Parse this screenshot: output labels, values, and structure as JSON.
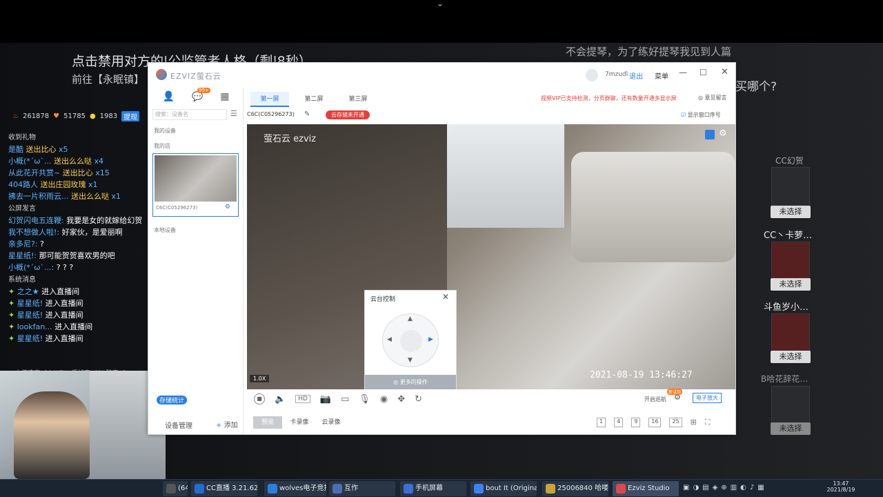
{
  "overlay": {
    "title": "点击禁用对方的|公监管者人格（剩|8秒）",
    "subtitle": "前往【永眠镇】",
    "right_top": "不会提琴，为了练好提琴我见到人篇",
    "right_q": "买哪个?",
    "stats": {
      "heat": "261878",
      "fans": "51785",
      "count": "1983",
      "badge": "提现"
    },
    "sections": {
      "gifts": "收到礼物",
      "public": "公屏发言",
      "system": "系统消息"
    },
    "gift_rows": [
      {
        "name": "是酷",
        "text": "送出比心",
        "count": "x5"
      },
      {
        "name": "小概(*´ω`...",
        "text": "送出么么哒",
        "count": "x4"
      },
      {
        "name": "从此花开共赏~",
        "text": "送出比心",
        "count": "x15"
      },
      {
        "name": "404路人",
        "text": "送出庄园玫瑰",
        "count": "x1"
      },
      {
        "name": "拂去一片积雨云...",
        "text": "送出么么哒",
        "count": "x1"
      }
    ],
    "public_rows": [
      {
        "name": "幻贺闪电五连鞭:",
        "text": "我要是女的就嫁给幻贺"
      },
      {
        "name": "我不想做人啦!:",
        "text": "好家伙，是爱丽啊"
      },
      {
        "name": "亲多尼?:",
        "text": "?"
      },
      {
        "name": "星星纸!:",
        "text": "那可能贺贺喜欢男的吧"
      },
      {
        "name": "小概(*´ω`...:",
        "text": "? ? ?"
      }
    ],
    "system_rows": [
      {
        "name": "之之★",
        "text": "进入直播间"
      },
      {
        "name": "星星纸!",
        "text": "进入直播间"
      },
      {
        "name": "星星纸!",
        "text": "进入直播间"
      },
      {
        "name": "lookfan...",
        "text": "进入直播间"
      },
      {
        "name": "星星纸!",
        "text": "进入直播间"
      }
    ],
    "bottom_bar": "上传速度: 204KB/s  丢帧率: 0%  码率: 3ms",
    "lottery": {
      "title1": "CC幻贺",
      "user1": "CC丶卡萝…",
      "user2": "斗鱼岁小…",
      "title2": "B哈花辞花…",
      "btn": "未选择"
    }
  },
  "app": {
    "logo": "EZVIZ萤石云",
    "user": "7mzudl",
    "logout": "退出",
    "menu": "菜单",
    "tabs": [
      "第一屏",
      "第二屏",
      "第三屏"
    ],
    "promo": "视频VIP已支持检测，分页群聊，还有数量开通多显示屏",
    "feedback": "意见留言",
    "notif_badge": "99+",
    "search_placeholder": "搜索：设备名",
    "my_devices": "我的设备",
    "my_store": "我的店",
    "device_id": "C6C(C05296273)",
    "local_devices": "本地设备",
    "device_manage": "设备管理",
    "add": "添加",
    "camera_label": "C6C(C05296273)",
    "cloud_badge": "云存储未开通",
    "show_window_no": "显示窗口序号",
    "watermark": "萤石云 ezviz",
    "timestamp": "2021-08-19  13:46:27",
    "zoom": "1.0X",
    "ptz": {
      "title": "云台控制",
      "more": "更多的操作"
    },
    "bottom_tabs": [
      "预览",
      "卡录像",
      "云录像"
    ],
    "open_tip": "开启巡航",
    "ext_btn": "电子放大",
    "new_badge": "新试用",
    "layouts": [
      "1",
      "4",
      "9",
      "16",
      "25"
    ],
    "left_badge": "存储统计"
  },
  "taskbar": {
    "items": [
      "(64-...",
      "CC直播 3.21.62",
      "wolves电子竞技...",
      "互作",
      "手机屏幕",
      "bout It (Original...",
      "25006840 哈喽...",
      "Ezviz Studio"
    ],
    "time": "13:47",
    "date": "2021/8/19"
  }
}
